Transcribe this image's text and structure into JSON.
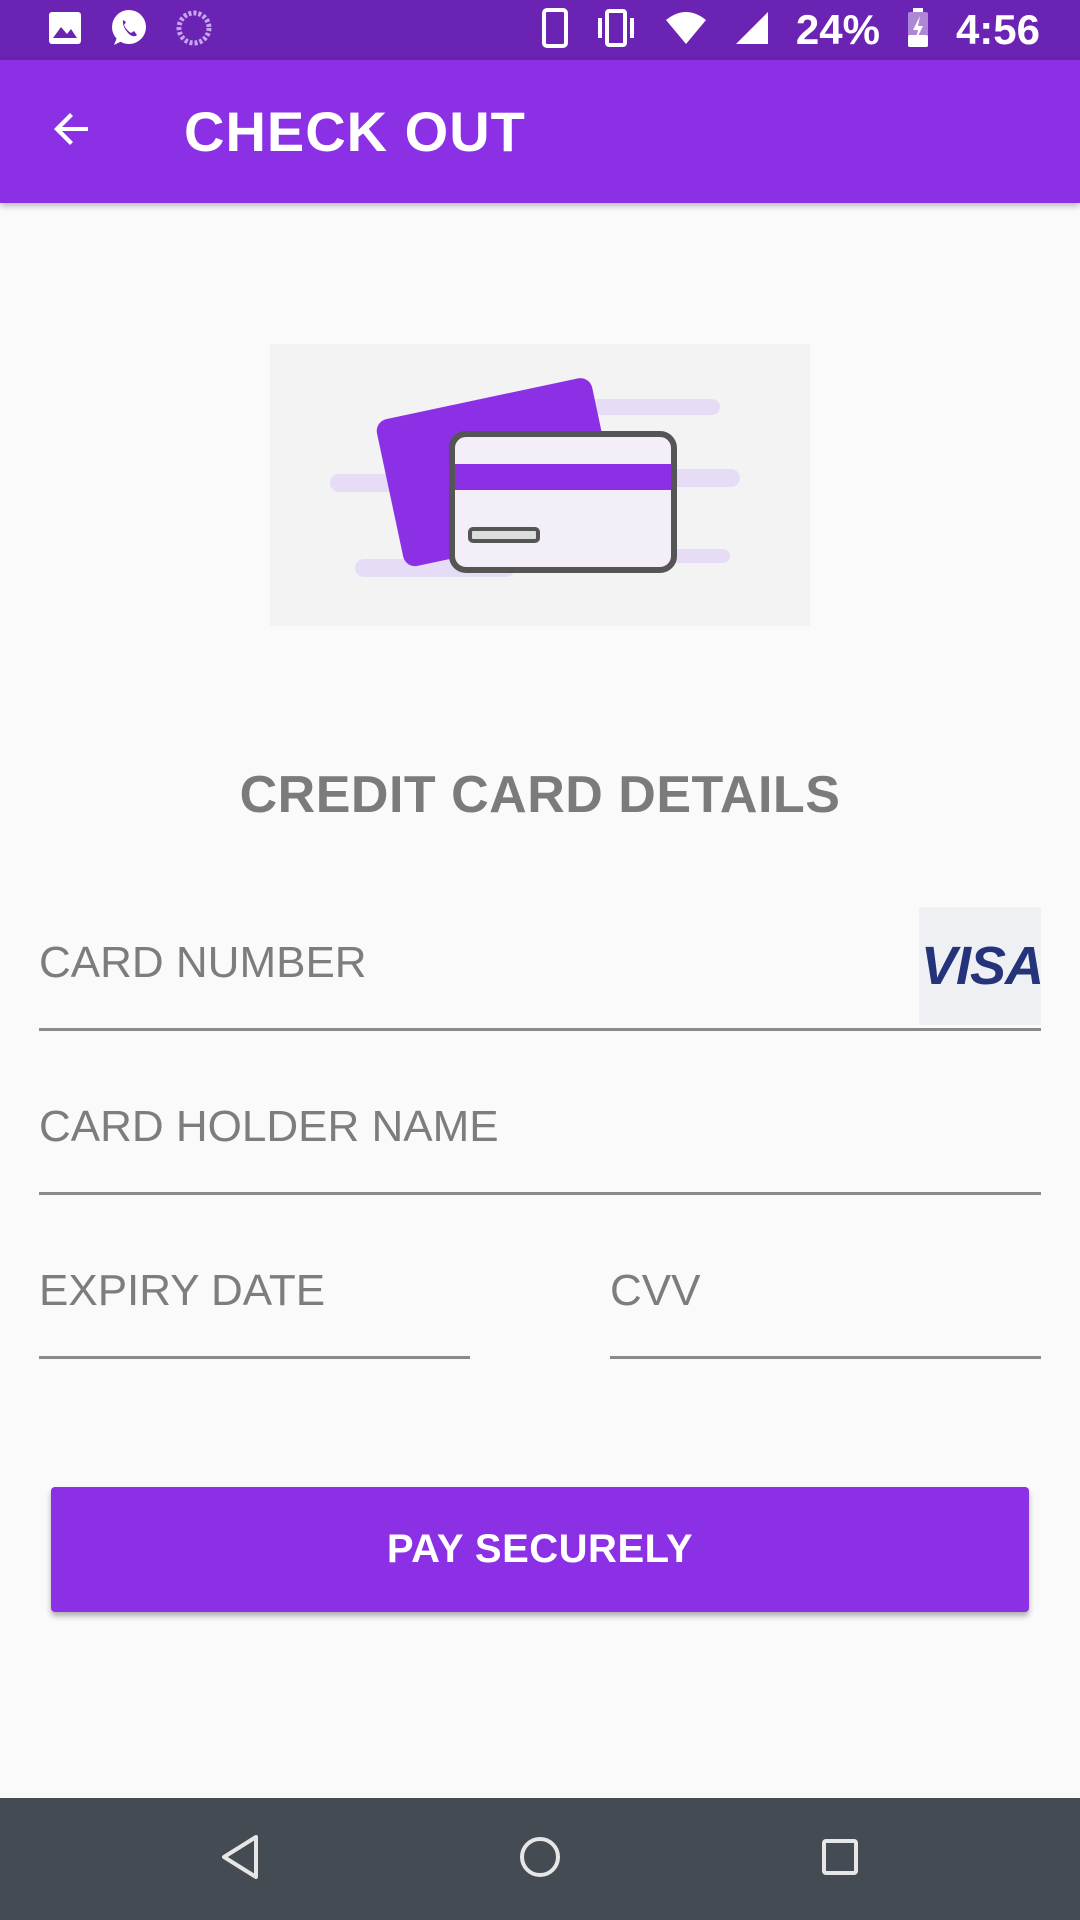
{
  "status_bar": {
    "battery": "24%",
    "time": "4:56"
  },
  "app_bar": {
    "title": "CHECK OUT"
  },
  "section": {
    "title": "CREDIT CARD DETAILS"
  },
  "form": {
    "card_number": {
      "value": "",
      "placeholder": "CARD NUMBER"
    },
    "card_holder": {
      "value": "",
      "placeholder": "CARD HOLDER NAME"
    },
    "expiry": {
      "value": "",
      "placeholder": "EXPIRY DATE"
    },
    "cvv": {
      "value": "",
      "placeholder": "CVV"
    },
    "card_brand": "VISA"
  },
  "actions": {
    "pay_label": "PAY SECURELY"
  },
  "colors": {
    "primary": "#8c30e6",
    "status_bar": "#6a23b3",
    "nav_bar": "#444b52",
    "section_text": "#7b7b7b"
  },
  "icons": {
    "status_left": [
      "image-icon",
      "whatsapp-icon",
      "loading-icon"
    ],
    "status_right": [
      "phone-icon",
      "vibrate-icon",
      "wifi-icon",
      "signal-icon",
      "battery-charging-icon"
    ],
    "nav": [
      "back-triangle-icon",
      "home-circle-icon",
      "recents-square-icon"
    ]
  }
}
